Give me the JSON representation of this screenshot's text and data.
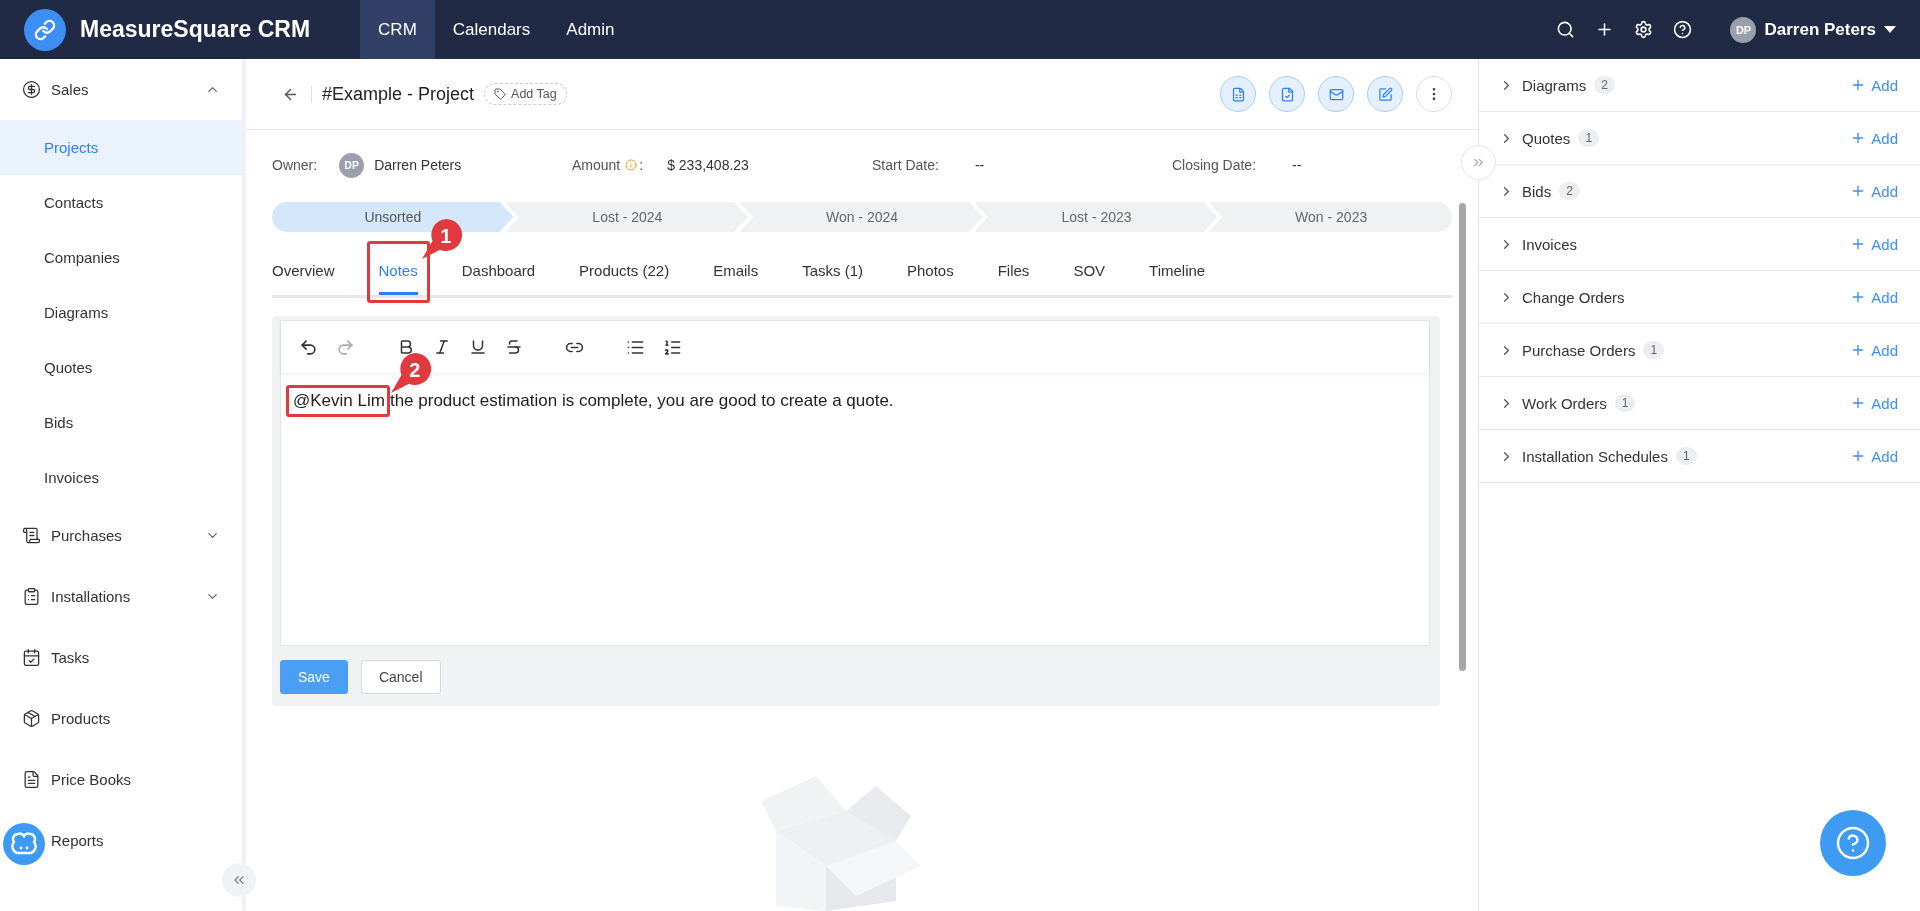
{
  "topbar": {
    "app_name": "MeasureSquare CRM",
    "nav": [
      {
        "label": "CRM",
        "selected": true
      },
      {
        "label": "Calendars",
        "selected": false
      },
      {
        "label": "Admin",
        "selected": false
      }
    ],
    "user": {
      "initials": "DP",
      "name": "Darren Peters"
    }
  },
  "sidebar": {
    "items": [
      {
        "label": "Sales",
        "expanded": true,
        "children": [
          {
            "label": "Projects",
            "selected": true
          },
          {
            "label": "Contacts",
            "selected": false
          },
          {
            "label": "Companies",
            "selected": false
          },
          {
            "label": "Diagrams",
            "selected": false
          },
          {
            "label": "Quotes",
            "selected": false
          },
          {
            "label": "Bids",
            "selected": false
          },
          {
            "label": "Invoices",
            "selected": false
          }
        ]
      },
      {
        "label": "Purchases",
        "expanded": false
      },
      {
        "label": "Installations",
        "expanded": false
      },
      {
        "label": "Tasks"
      },
      {
        "label": "Products"
      },
      {
        "label": "Price Books"
      },
      {
        "label": "Reports"
      }
    ]
  },
  "project": {
    "title": "#Example - Project",
    "add_tag": "Add Tag",
    "fields": [
      {
        "kind": "person",
        "label": "Owner:",
        "initials": "DP",
        "value": "Darren Peters"
      },
      {
        "kind": "amount",
        "label": "Amount",
        "suffix": ":",
        "value": "$ 233,408.23"
      },
      {
        "kind": "text",
        "label": "Start Date:",
        "value": "--"
      },
      {
        "kind": "text",
        "label": "Closing Date:",
        "value": "--"
      }
    ]
  },
  "stages": [
    {
      "label": "Unsorted",
      "selected": true
    },
    {
      "label": "Lost - 2024",
      "selected": false
    },
    {
      "label": "Won - 2024",
      "selected": false
    },
    {
      "label": "Lost - 2023",
      "selected": false
    },
    {
      "label": "Won - 2023",
      "selected": false
    }
  ],
  "tabs": [
    {
      "label": "Overview",
      "selected": false
    },
    {
      "label": "Notes",
      "selected": true,
      "callout": "1"
    },
    {
      "label": "Dashboard",
      "selected": false
    },
    {
      "label": "Products (22)",
      "selected": false
    },
    {
      "label": "Emails",
      "selected": false
    },
    {
      "label": "Tasks (1)",
      "selected": false
    },
    {
      "label": "Photos",
      "selected": false
    },
    {
      "label": "Files",
      "selected": false
    },
    {
      "label": "SOV",
      "selected": false
    },
    {
      "label": "Timeline",
      "selected": false
    }
  ],
  "editor": {
    "toolbar": {
      "undo_disabled": false,
      "redo_disabled": true
    },
    "mention": "@Kevin Lim",
    "mention_callout": "2",
    "text": "the product estimation is complete, you are good to create a quote.",
    "save": "Save",
    "cancel": "Cancel"
  },
  "related": [
    {
      "label": "Diagrams",
      "count": "2",
      "add": "Add"
    },
    {
      "label": "Quotes",
      "count": "1",
      "add": "Add"
    },
    {
      "label": "Bids",
      "count": "2",
      "add": "Add"
    },
    {
      "label": "Invoices",
      "add": "Add"
    },
    {
      "label": "Change Orders",
      "add": "Add"
    },
    {
      "label": "Purchase Orders",
      "count": "1",
      "add": "Add"
    },
    {
      "label": "Work Orders",
      "count": "1",
      "add": "Add"
    },
    {
      "label": "Installation Schedules",
      "count": "1",
      "add": "Add"
    }
  ]
}
